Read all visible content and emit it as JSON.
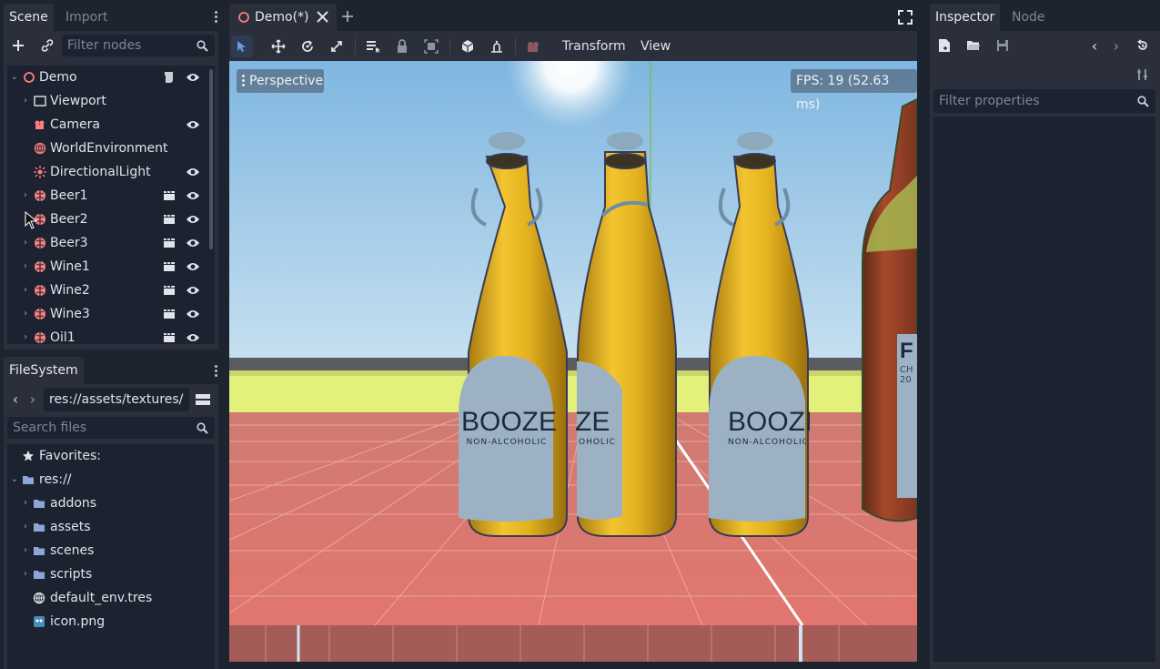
{
  "scene_dock": {
    "tabs": [
      "Scene",
      "Import"
    ],
    "filter_placeholder": "Filter nodes",
    "nodes": [
      {
        "label": "Demo",
        "icon": "node3d-icon",
        "expandable": true,
        "expanded": true,
        "script": true,
        "visible": true
      },
      {
        "label": "Viewport",
        "icon": "viewport-icon",
        "expandable": true
      },
      {
        "label": "Camera",
        "icon": "camera-icon",
        "visible": true
      },
      {
        "label": "WorldEnvironment",
        "icon": "globe-icon"
      },
      {
        "label": "DirectionalLight",
        "icon": "light-icon",
        "visible": true
      },
      {
        "label": "Beer1",
        "icon": "scene-instance-icon",
        "expandable": true,
        "clapper": true,
        "visible": true
      },
      {
        "label": "Beer2",
        "icon": "scene-instance-icon",
        "expandable": true,
        "clapper": true,
        "visible": true
      },
      {
        "label": "Beer3",
        "icon": "scene-instance-icon",
        "expandable": true,
        "clapper": true,
        "visible": true
      },
      {
        "label": "Wine1",
        "icon": "scene-instance-icon",
        "expandable": true,
        "clapper": true,
        "visible": true
      },
      {
        "label": "Wine2",
        "icon": "scene-instance-icon",
        "expandable": true,
        "clapper": true,
        "visible": true
      },
      {
        "label": "Wine3",
        "icon": "scene-instance-icon",
        "expandable": true,
        "clapper": true,
        "visible": true
      },
      {
        "label": "Oil1",
        "icon": "scene-instance-icon",
        "expandable": true,
        "clapper": true,
        "visible": true
      }
    ]
  },
  "filesystem": {
    "tab": "FileSystem",
    "path": "res://assets/textures/",
    "search_placeholder": "Search files",
    "items": [
      {
        "label": "Favorites:",
        "icon": "star-icon"
      },
      {
        "label": "res://",
        "icon": "folder-icon",
        "expanded": true
      },
      {
        "label": "addons",
        "icon": "folder-icon"
      },
      {
        "label": "assets",
        "icon": "folder-icon"
      },
      {
        "label": "scenes",
        "icon": "folder-icon"
      },
      {
        "label": "scripts",
        "icon": "folder-icon"
      },
      {
        "label": "default_env.tres",
        "icon": "globe-icon"
      },
      {
        "label": "icon.png",
        "icon": "image-icon"
      }
    ]
  },
  "editor": {
    "tab_label": "Demo(*)",
    "menus": [
      "Transform",
      "View"
    ],
    "viewport_label": "Perspective",
    "fps_label": "FPS: 19 (52.63 ms)",
    "bottle_label_brand": "BOOZE",
    "bottle_label_sub": "NON-ALCOHOLIC",
    "partial_label": "ZE",
    "partial_label_sub": "OHOLIC",
    "wine_label_big": "F",
    "wine_label_sub1": "CH",
    "wine_label_sub2": "20"
  },
  "inspector": {
    "tabs": [
      "Inspector",
      "Node"
    ],
    "filter_placeholder": "Filter properties"
  },
  "colors": {
    "accent": "#699ce8",
    "node_red": "#fc7f7f",
    "panel": "#2a2f3b",
    "tree_bg": "#1d2230"
  }
}
